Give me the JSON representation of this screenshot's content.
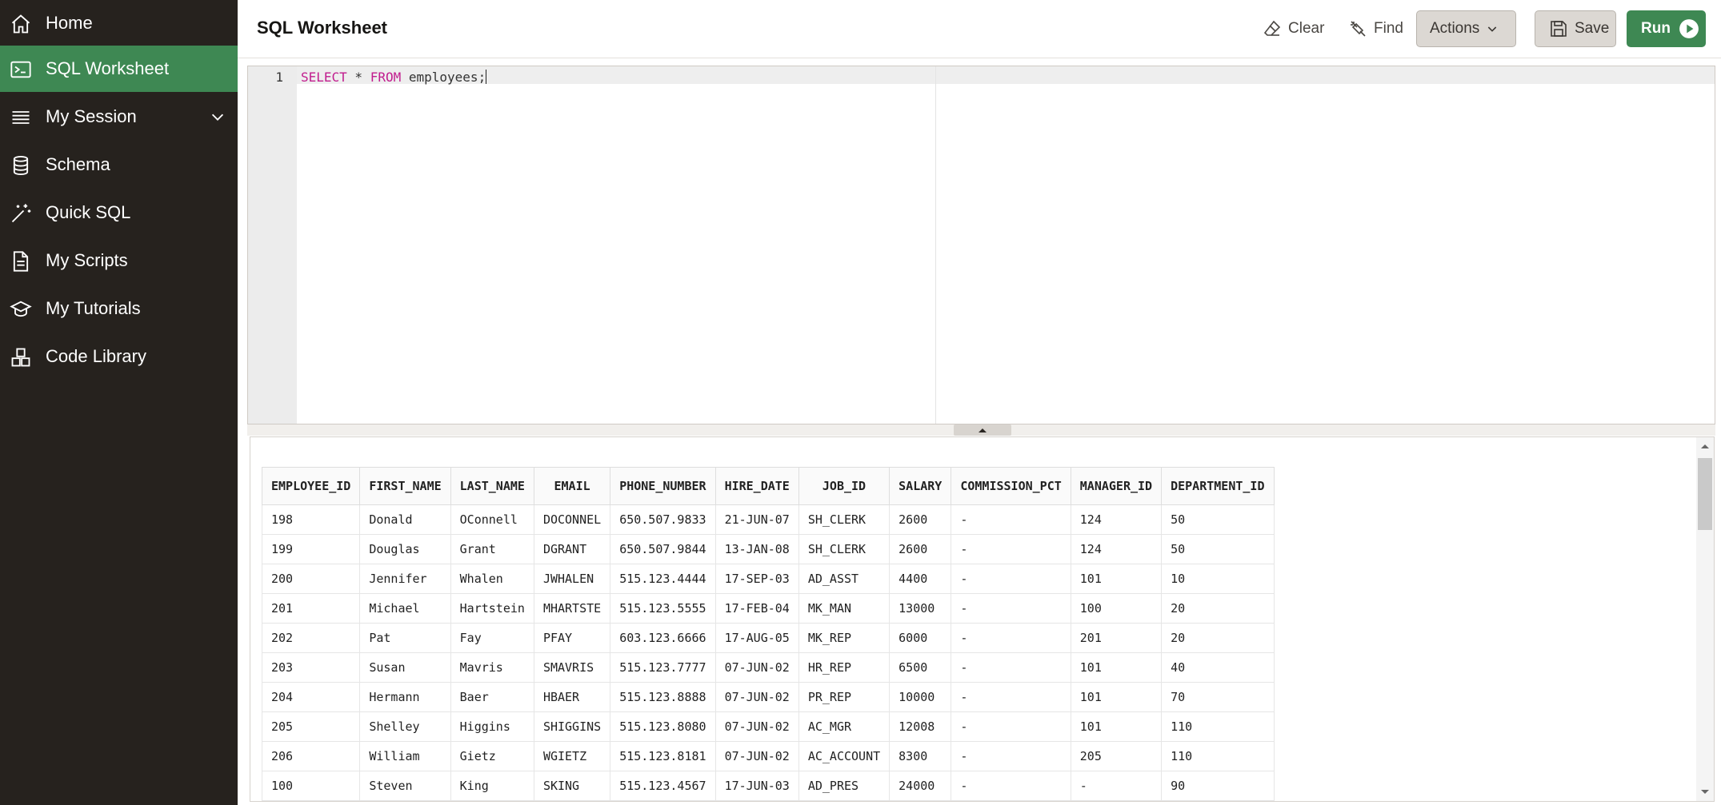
{
  "sidebar": {
    "items": [
      {
        "label": "Home",
        "icon": "home-icon"
      },
      {
        "label": "SQL Worksheet",
        "icon": "terminal-icon"
      },
      {
        "label": "My Session",
        "icon": "list-icon"
      },
      {
        "label": "Schema",
        "icon": "database-icon"
      },
      {
        "label": "Quick SQL",
        "icon": "magic-wand-icon"
      },
      {
        "label": "My Scripts",
        "icon": "document-icon"
      },
      {
        "label": "My Tutorials",
        "icon": "graduation-cap-icon"
      },
      {
        "label": "Code Library",
        "icon": "blocks-icon"
      }
    ],
    "active": "SQL Worksheet"
  },
  "header": {
    "title": "SQL Worksheet",
    "clear_label": "Clear",
    "find_label": "Find",
    "actions_label": "Actions",
    "save_label": "Save",
    "run_label": "Run"
  },
  "editor": {
    "line_number": "1",
    "kw_select": "SELECT",
    "star": " * ",
    "kw_from": "FROM",
    "rest": " employees;"
  },
  "results": {
    "columns": [
      "EMPLOYEE_ID",
      "FIRST_NAME",
      "LAST_NAME",
      "EMAIL",
      "PHONE_NUMBER",
      "HIRE_DATE",
      "JOB_ID",
      "SALARY",
      "COMMISSION_PCT",
      "MANAGER_ID",
      "DEPARTMENT_ID"
    ],
    "rows": [
      [
        "198",
        "Donald",
        "OConnell",
        "DOCONNEL",
        "650.507.9833",
        "21-JUN-07",
        "SH_CLERK",
        "2600",
        "-",
        "124",
        "50"
      ],
      [
        "199",
        "Douglas",
        "Grant",
        "DGRANT",
        "650.507.9844",
        "13-JAN-08",
        "SH_CLERK",
        "2600",
        "-",
        "124",
        "50"
      ],
      [
        "200",
        "Jennifer",
        "Whalen",
        "JWHALEN",
        "515.123.4444",
        "17-SEP-03",
        "AD_ASST",
        "4400",
        "-",
        "101",
        "10"
      ],
      [
        "201",
        "Michael",
        "Hartstein",
        "MHARTSTE",
        "515.123.5555",
        "17-FEB-04",
        "MK_MAN",
        "13000",
        "-",
        "100",
        "20"
      ],
      [
        "202",
        "Pat",
        "Fay",
        "PFAY",
        "603.123.6666",
        "17-AUG-05",
        "MK_REP",
        "6000",
        "-",
        "201",
        "20"
      ],
      [
        "203",
        "Susan",
        "Mavris",
        "SMAVRIS",
        "515.123.7777",
        "07-JUN-02",
        "HR_REP",
        "6500",
        "-",
        "101",
        "40"
      ],
      [
        "204",
        "Hermann",
        "Baer",
        "HBAER",
        "515.123.8888",
        "07-JUN-02",
        "PR_REP",
        "10000",
        "-",
        "101",
        "70"
      ],
      [
        "205",
        "Shelley",
        "Higgins",
        "SHIGGINS",
        "515.123.8080",
        "07-JUN-02",
        "AC_MGR",
        "12008",
        "-",
        "101",
        "110"
      ],
      [
        "206",
        "William",
        "Gietz",
        "WGIETZ",
        "515.123.8181",
        "07-JUN-02",
        "AC_ACCOUNT",
        "8300",
        "-",
        "205",
        "110"
      ],
      [
        "100",
        "Steven",
        "King",
        "SKING",
        "515.123.4567",
        "17-JUN-03",
        "AD_PRES",
        "24000",
        "-",
        "-",
        "90"
      ]
    ]
  },
  "colors": {
    "sidebar_bg": "#26221e",
    "active_green": "#3e8853",
    "keyword": "#c11d8e"
  }
}
